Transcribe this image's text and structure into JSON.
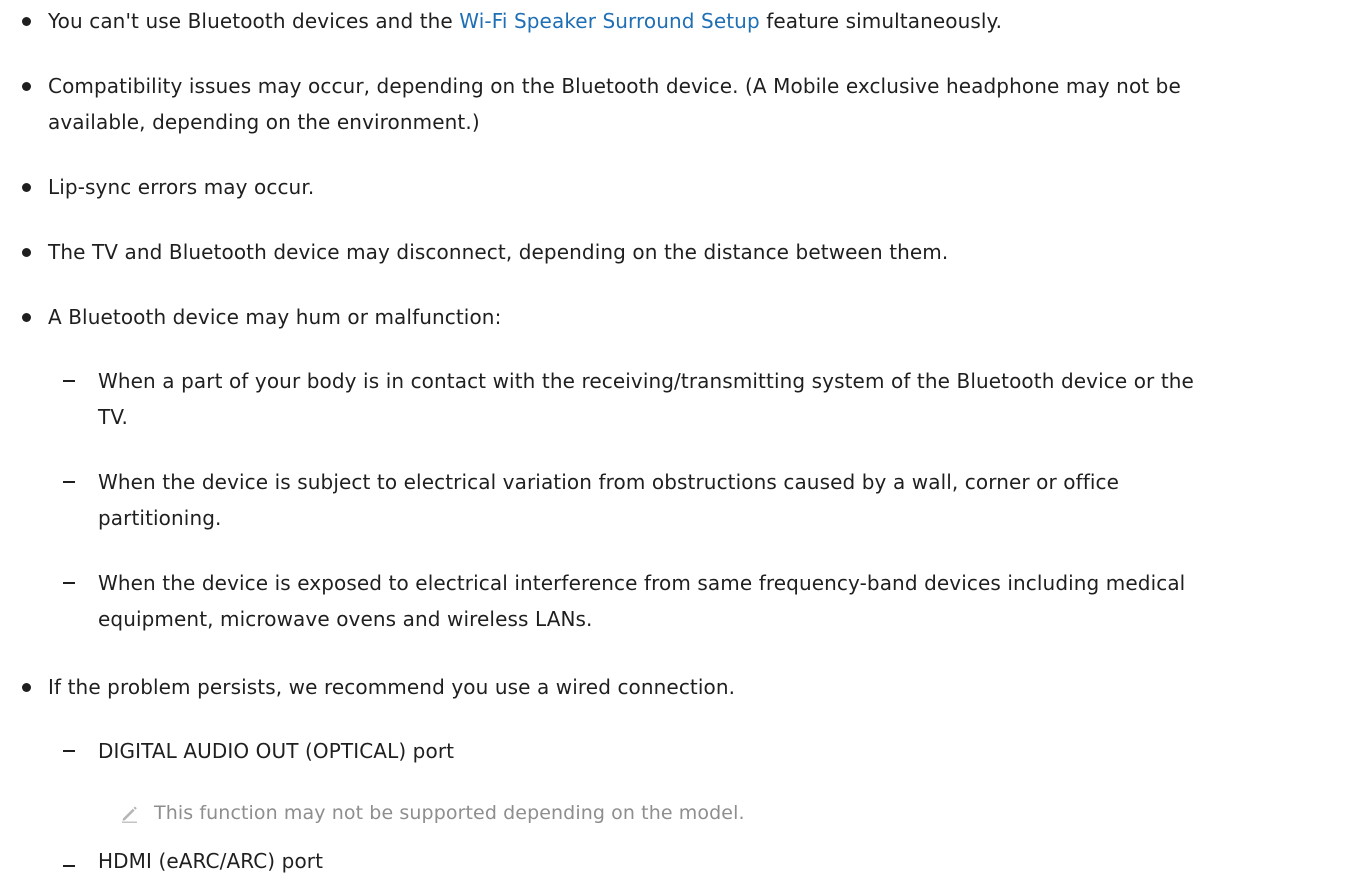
{
  "list": {
    "item1": {
      "before": "You can't use Bluetooth devices and the ",
      "link": "Wi-Fi Speaker Surround Setup",
      "after": " feature simultaneously."
    },
    "item2": {
      "line1": "Compatibility issues may occur, depending on the Bluetooth device. (A Mobile exclusive headphone may not be",
      "line2": "available, depending on the environment.)"
    },
    "item3": "Lip-sync errors may occur.",
    "item4": "The TV and Bluetooth device may disconnect, depending on the distance between them.",
    "item5": {
      "text": "A Bluetooth device may hum or malfunction:",
      "sub1": {
        "line1": "When a part of your body is in contact with the receiving/transmitting system of the Bluetooth device or the",
        "line2": "TV."
      },
      "sub2": {
        "line1": "When the device is subject to electrical variation from obstructions caused by a wall, corner or office",
        "line2": "partitioning."
      },
      "sub3": {
        "line1": "When the device is exposed to electrical interference from same frequency-band devices including medical",
        "line2": "equipment, microwave ovens and wireless LANs."
      }
    },
    "item6": {
      "text": "If the problem persists, we recommend you use a wired connection.",
      "sub1": "DIGITAL AUDIO OUT (OPTICAL) port",
      "note": "This function may not be supported depending on the model.",
      "sub2": "HDMI (eARC/ARC) port"
    }
  },
  "icons": {
    "note": "pencil-icon"
  },
  "colors": {
    "text": "#1f1f1f",
    "link": "#1f6fb4",
    "note": "#8e8e8e"
  }
}
